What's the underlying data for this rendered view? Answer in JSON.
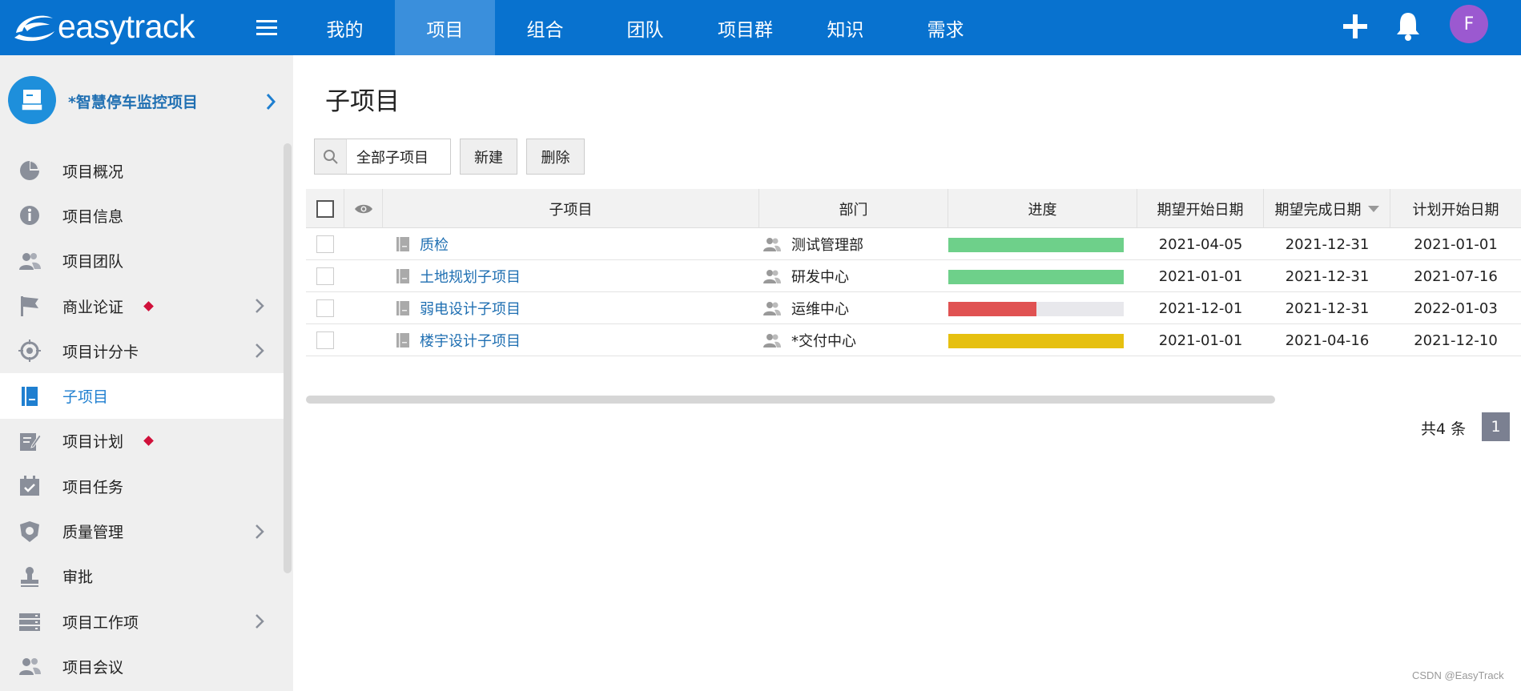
{
  "app": {
    "logo_text": "easytrack"
  },
  "nav": {
    "items": [
      {
        "label": "我的"
      },
      {
        "label": "项目"
      },
      {
        "label": "组合"
      },
      {
        "label": "团队"
      },
      {
        "label": "项目群"
      },
      {
        "label": "知识"
      },
      {
        "label": "需求"
      }
    ],
    "active_index": 1
  },
  "user": {
    "avatar_letter": "F",
    "avatar_color": "#9b59d0"
  },
  "sidebar": {
    "project_name": "*智慧停车监控项目",
    "items": [
      {
        "label": "项目概况",
        "icon": "pie-chart-icon"
      },
      {
        "label": "项目信息",
        "icon": "info-icon"
      },
      {
        "label": "项目团队",
        "icon": "team-icon"
      },
      {
        "label": "商业论证",
        "icon": "flag-icon",
        "marker": true,
        "chevron": true
      },
      {
        "label": "项目计分卡",
        "icon": "target-icon",
        "chevron": true
      },
      {
        "label": "子项目",
        "icon": "subproject-icon",
        "active": true
      },
      {
        "label": "项目计划",
        "icon": "plan-edit-icon",
        "marker": true
      },
      {
        "label": "项目任务",
        "icon": "calendar-check-icon"
      },
      {
        "label": "质量管理",
        "icon": "shield-icon",
        "chevron": true
      },
      {
        "label": "审批",
        "icon": "stamp-icon"
      },
      {
        "label": "项目工作项",
        "icon": "server-list-icon",
        "chevron": true
      },
      {
        "label": "项目会议",
        "icon": "meeting-icon"
      }
    ]
  },
  "main": {
    "title": "子项目",
    "filter_label": "全部子项目",
    "new_label": "新建",
    "delete_label": "删除",
    "columns": {
      "name": "子项目",
      "dept": "部门",
      "progress": "进度",
      "exp_start": "期望开始日期",
      "exp_end": "期望完成日期",
      "plan_start": "计划开始日期"
    },
    "rows": [
      {
        "name": "质检",
        "dept": "测试管理部",
        "progress": 1.0,
        "progress_color": "#6ed08a",
        "exp_start": "2021-04-05",
        "exp_end": "2021-12-31",
        "plan_start": "2021-01-01"
      },
      {
        "name": "土地规划子项目",
        "dept": "研发中心",
        "progress": 1.0,
        "progress_color": "#6ed08a",
        "exp_start": "2021-01-01",
        "exp_end": "2021-12-31",
        "plan_start": "2021-07-16"
      },
      {
        "name": "弱电设计子项目",
        "dept": "运维中心",
        "progress": 0.5,
        "progress_color": "#e05252",
        "exp_start": "2021-12-01",
        "exp_end": "2021-12-31",
        "plan_start": "2022-01-03"
      },
      {
        "name": "楼宇设计子项目",
        "dept": "*交付中心",
        "progress": 1.0,
        "progress_color": "#e6c010",
        "exp_start": "2021-01-01",
        "exp_end": "2021-04-16",
        "plan_start": "2021-12-10"
      }
    ],
    "total_text": "共4 条",
    "page": "1"
  },
  "watermark": "CSDN @EasyTrack",
  "colors": {
    "topbar": "#0872cf",
    "nav_active": "#3a8fdc",
    "link": "#1f6fb2",
    "sidebar_bg": "#efefef"
  }
}
